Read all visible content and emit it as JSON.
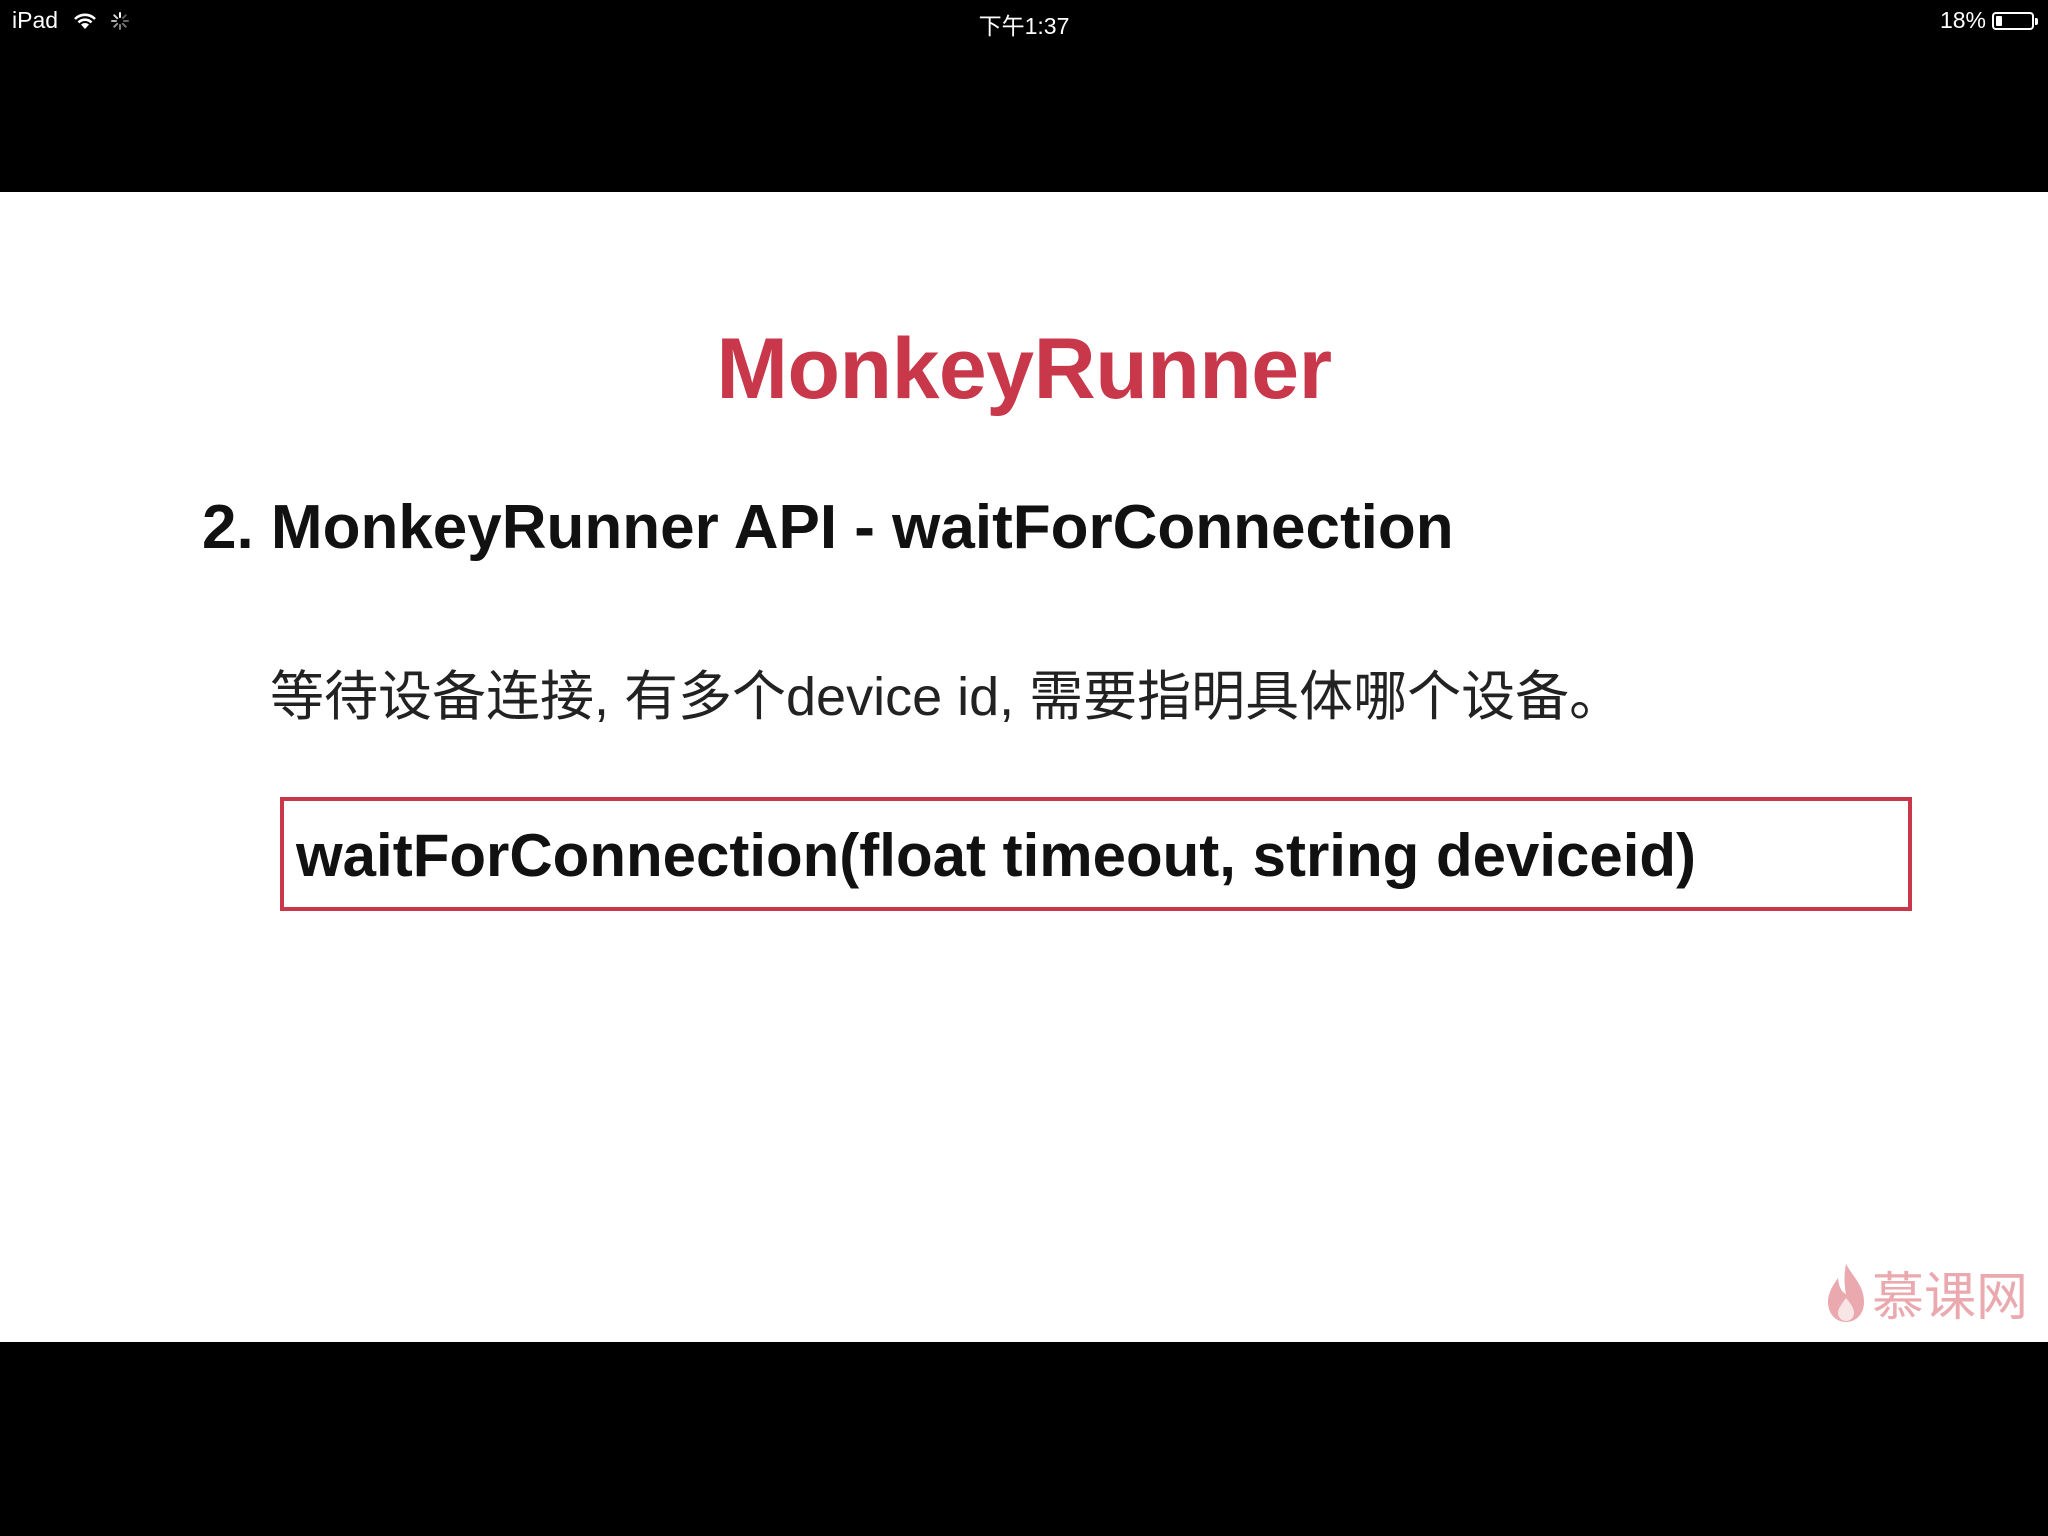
{
  "status_bar": {
    "carrier": "iPad",
    "time": "下午1:37",
    "battery_percent": "18%",
    "battery_level": 0.18
  },
  "slide": {
    "title": "MonkeyRunner",
    "heading": "2. MonkeyRunner API - waitForConnection",
    "description": "等待设备连接, 有多个device id, 需要指明具体哪个设备。",
    "code": "waitForConnection(float timeout, string deviceid)",
    "watermark": "慕课网"
  },
  "colors": {
    "accent": "#c8374a",
    "text": "#111111",
    "background": "#ffffff",
    "letterbox": "#000000"
  },
  "icons": [
    "wifi-icon",
    "activity-spinner-icon",
    "battery-icon",
    "flame-logo-icon"
  ]
}
